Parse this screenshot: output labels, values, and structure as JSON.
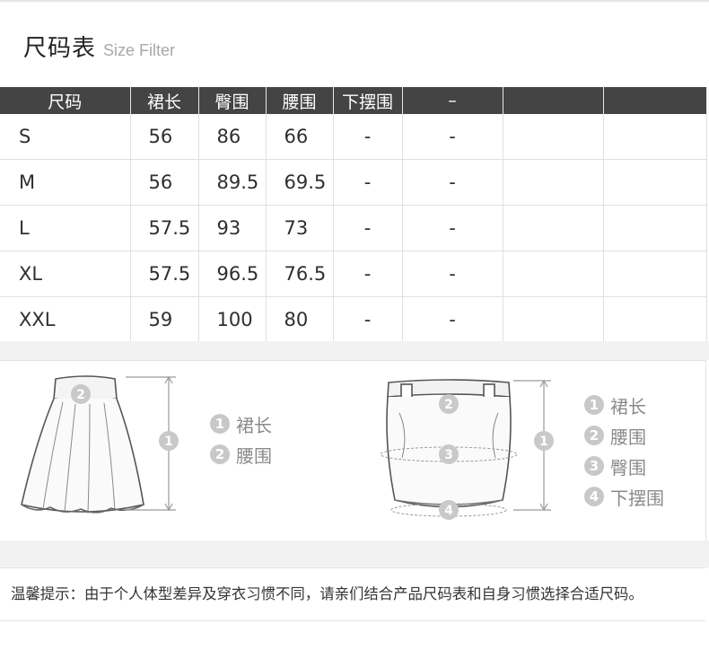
{
  "header": {
    "title": "尺码表",
    "subtitle": "Size Filter"
  },
  "table": {
    "columns": [
      "尺码",
      "裙长",
      "臀围",
      "腰围",
      "下摆围",
      "–",
      "",
      ""
    ],
    "rows": [
      [
        "S",
        "56",
        "86",
        "66",
        "-",
        "-",
        "",
        ""
      ],
      [
        "M",
        "56",
        "89.5",
        "69.5",
        "-",
        "-",
        "",
        ""
      ],
      [
        "L",
        "57.5",
        "93",
        "73",
        "-",
        "-",
        "",
        ""
      ],
      [
        "XL",
        "57.5",
        "96.5",
        "76.5",
        "-",
        "-",
        "",
        ""
      ],
      [
        "XXL",
        "59",
        "100",
        "80",
        "-",
        "-",
        "",
        ""
      ]
    ]
  },
  "diagram": {
    "skirt_a": {
      "markers": [
        "2",
        "1"
      ],
      "legend": [
        {
          "num": "1",
          "label": "裙长"
        },
        {
          "num": "2",
          "label": "腰围"
        }
      ]
    },
    "skirt_b": {
      "markers": [
        "2",
        "3",
        "4",
        "1"
      ],
      "legend": [
        {
          "num": "1",
          "label": "裙长"
        },
        {
          "num": "2",
          "label": "腰围"
        },
        {
          "num": "3",
          "label": "臀围"
        },
        {
          "num": "4",
          "label": "下摆围"
        }
      ]
    }
  },
  "notice": "温馨提示：由于个人体型差异及穿衣习惯不同，请亲们结合产品尺码表和自身习惯选择合适尺码。"
}
